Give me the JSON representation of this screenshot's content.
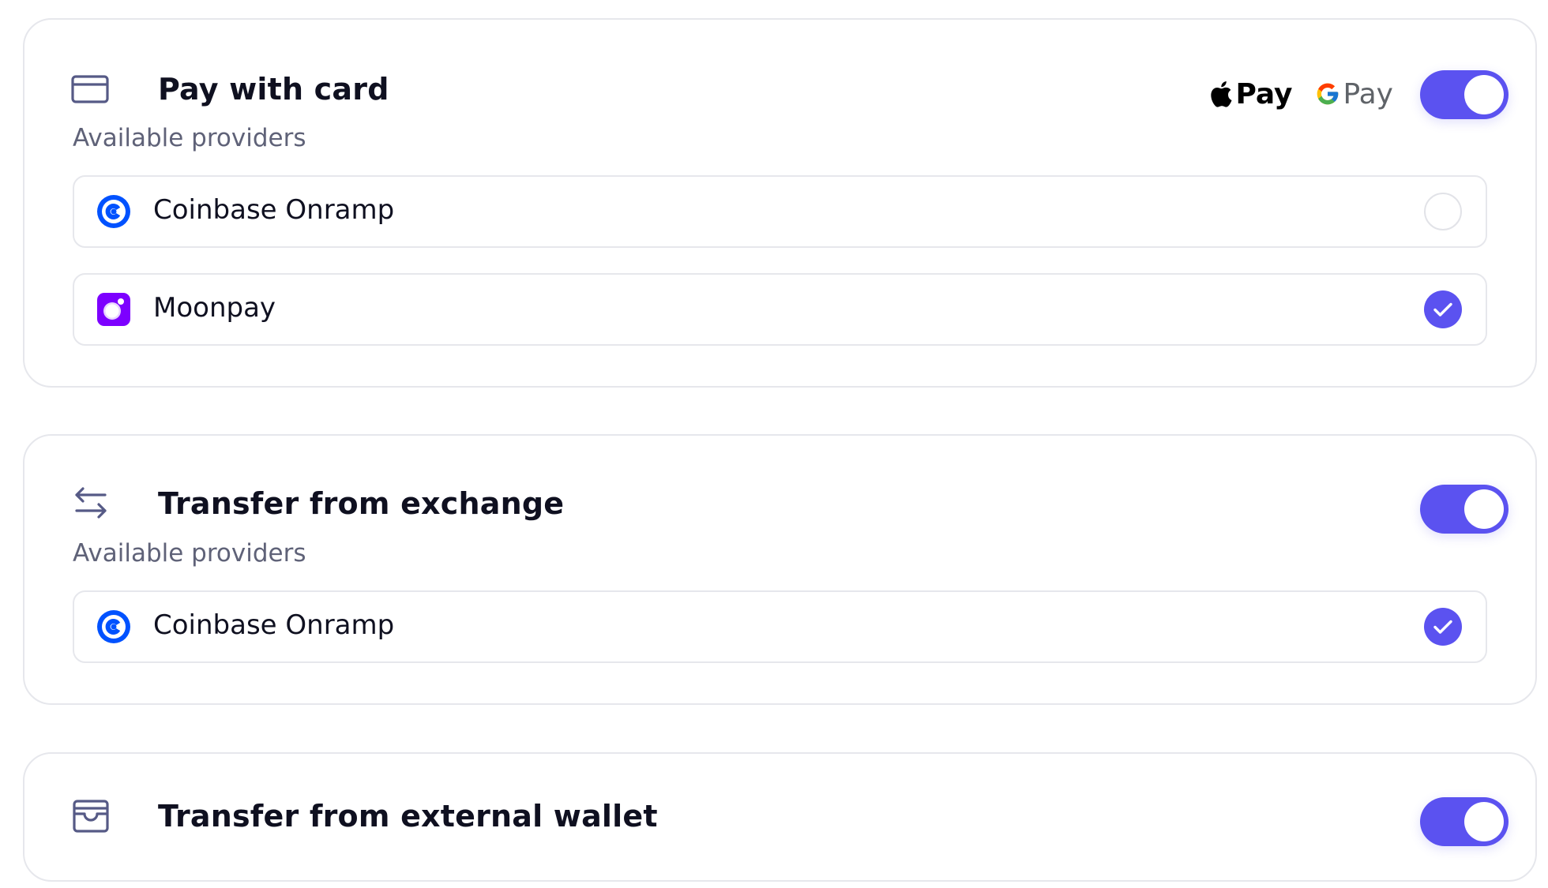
{
  "colors": {
    "accent": "#5b52f0",
    "border": "#e6e7ec",
    "muted_text": "#5f6278"
  },
  "sections": [
    {
      "title": "Pay with card",
      "icon": "credit-card-icon",
      "enabled": true,
      "wallets": [
        {
          "label": "Pay",
          "icon": "apple-logo-icon"
        },
        {
          "label": "Pay",
          "icon": "google-logo-icon"
        }
      ],
      "providers_label": "Available providers",
      "providers": [
        {
          "name": "Coinbase Onramp",
          "icon": "coinbase-logo-icon",
          "selected": false
        },
        {
          "name": "Moonpay",
          "icon": "moonpay-logo-icon",
          "selected": true
        }
      ]
    },
    {
      "title": "Transfer from exchange",
      "icon": "transfer-arrows-icon",
      "enabled": true,
      "providers_label": "Available providers",
      "providers": [
        {
          "name": "Coinbase Onramp",
          "icon": "coinbase-logo-icon",
          "selected": true
        }
      ]
    },
    {
      "title": "Transfer from external wallet",
      "icon": "wallet-icon",
      "enabled": true
    }
  ]
}
